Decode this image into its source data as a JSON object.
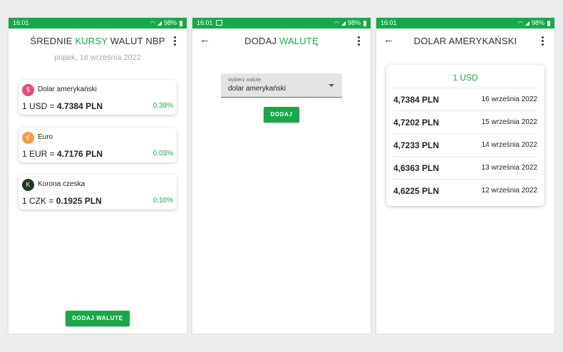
{
  "status": {
    "time": "16:01",
    "battery": "98%"
  },
  "screen1": {
    "title_prefix": "ŚREDNIE",
    "title_accent": "KURSY",
    "title_suffix": "WALUT NBP",
    "date": "piątek, 16 września 2022",
    "cards": [
      {
        "icon": "$",
        "icon_color": "#e84a7c",
        "name": "Dolar amerykański",
        "rate_prefix": "1 USD = ",
        "rate_value": "4.7384 PLN",
        "change": "0,39%"
      },
      {
        "icon": "€",
        "icon_color": "#f59b42",
        "name": "Euro",
        "rate_prefix": "1 EUR = ",
        "rate_value": "4.7176 PLN",
        "change": "0,03%"
      },
      {
        "icon": "K",
        "icon_color": "#1f3a1f",
        "name": "Korona czeska",
        "rate_prefix": "1 CZK = ",
        "rate_value": "0.1925 PLN",
        "change": "0,10%"
      }
    ],
    "add_button": "DODAJ WALUTĘ"
  },
  "screen2": {
    "title_prefix": "DODAJ",
    "title_accent": "WALUTĘ",
    "select_label": "wybierz walutę",
    "select_value": "dolar amerykański",
    "add_button": "DODAJ"
  },
  "screen3": {
    "title": "DOLAR AMERYKAŃSKI",
    "unit": "1 USD",
    "rows": [
      {
        "value": "4,7384 PLN",
        "date": "16 września 2022"
      },
      {
        "value": "4,7202 PLN",
        "date": "15 września 2022"
      },
      {
        "value": "4,7233 PLN",
        "date": "14 września 2022"
      },
      {
        "value": "4,6363 PLN",
        "date": "13 września 2022"
      },
      {
        "value": "4,6225 PLN",
        "date": "12 września 2022"
      }
    ]
  },
  "colors": {
    "accent": "#18a84a",
    "statusbar": "#18a84a"
  }
}
